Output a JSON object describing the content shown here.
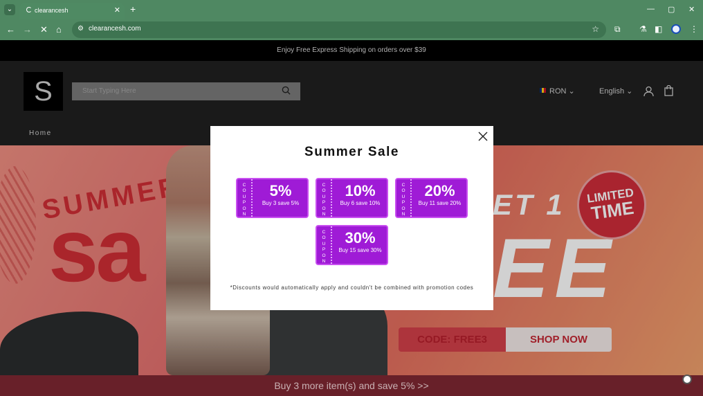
{
  "browser": {
    "tab_title": "clearancesh",
    "url": "clearancesh.com",
    "new_tab_label": "+",
    "close_tab_label": "✕"
  },
  "site": {
    "announcement": "Enjoy Free Express Shipping on orders over $39",
    "logo_letter": "S",
    "search_placeholder": "Start Typing Here",
    "currency": "RON",
    "language": "English",
    "nav_home": "Home"
  },
  "hero": {
    "summer": "SUMMER",
    "sale_partial": "sa",
    "get_text": "ET 1",
    "free_text": "EE",
    "limited": "LIMITED",
    "time": "TIME",
    "code": "CODE: FREE3",
    "shop_now": "SHOP NOW"
  },
  "promo_bar": "Buy 3 more item(s) and save 5%  >>",
  "modal": {
    "title": "Summer Sale",
    "coupon_stub": "COUPON",
    "coupons": [
      {
        "percent": "5%",
        "desc": "Buy 3 save 5%"
      },
      {
        "percent": "10%",
        "desc": "Buy 6 save 10%"
      },
      {
        "percent": "20%",
        "desc": "Buy 11 save 20%"
      },
      {
        "percent": "30%",
        "desc": "Buy 15 save 30%"
      }
    ],
    "disclaimer": "*Discounts would automatically apply and couldn't be combined with promotion codes"
  },
  "colors": {
    "chrome": "#4f8862",
    "coupon": "#9f1bd6",
    "promo_bar": "#7f2832"
  }
}
